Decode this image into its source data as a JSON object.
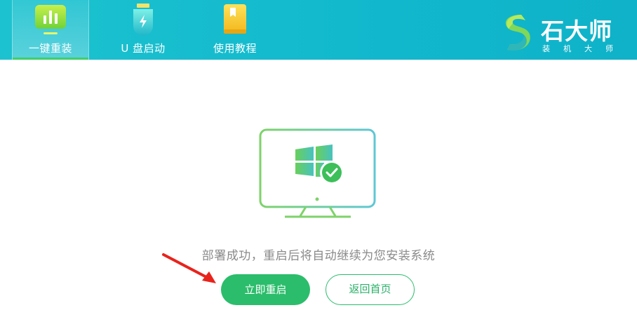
{
  "header": {
    "tabs": [
      {
        "label": "一键重装",
        "icon": "chart-bars-icon",
        "active": true
      },
      {
        "label": "U 盘启动",
        "icon": "usb-drive-icon",
        "active": false
      },
      {
        "label": "使用教程",
        "icon": "book-icon",
        "active": false
      }
    ],
    "brand": {
      "name": "石大师",
      "subtitle": "装机大师"
    }
  },
  "main": {
    "illustration_icon": "monitor-windows-check-icon",
    "status_message": "部署成功，重启后将自动继续为您安装系统",
    "primary_button": "立即重启",
    "secondary_button": "返回首页"
  },
  "colors": {
    "header_bg": "#11b8cd",
    "accent_green": "#2bbd6b",
    "text_gray": "#8a8a8a"
  }
}
